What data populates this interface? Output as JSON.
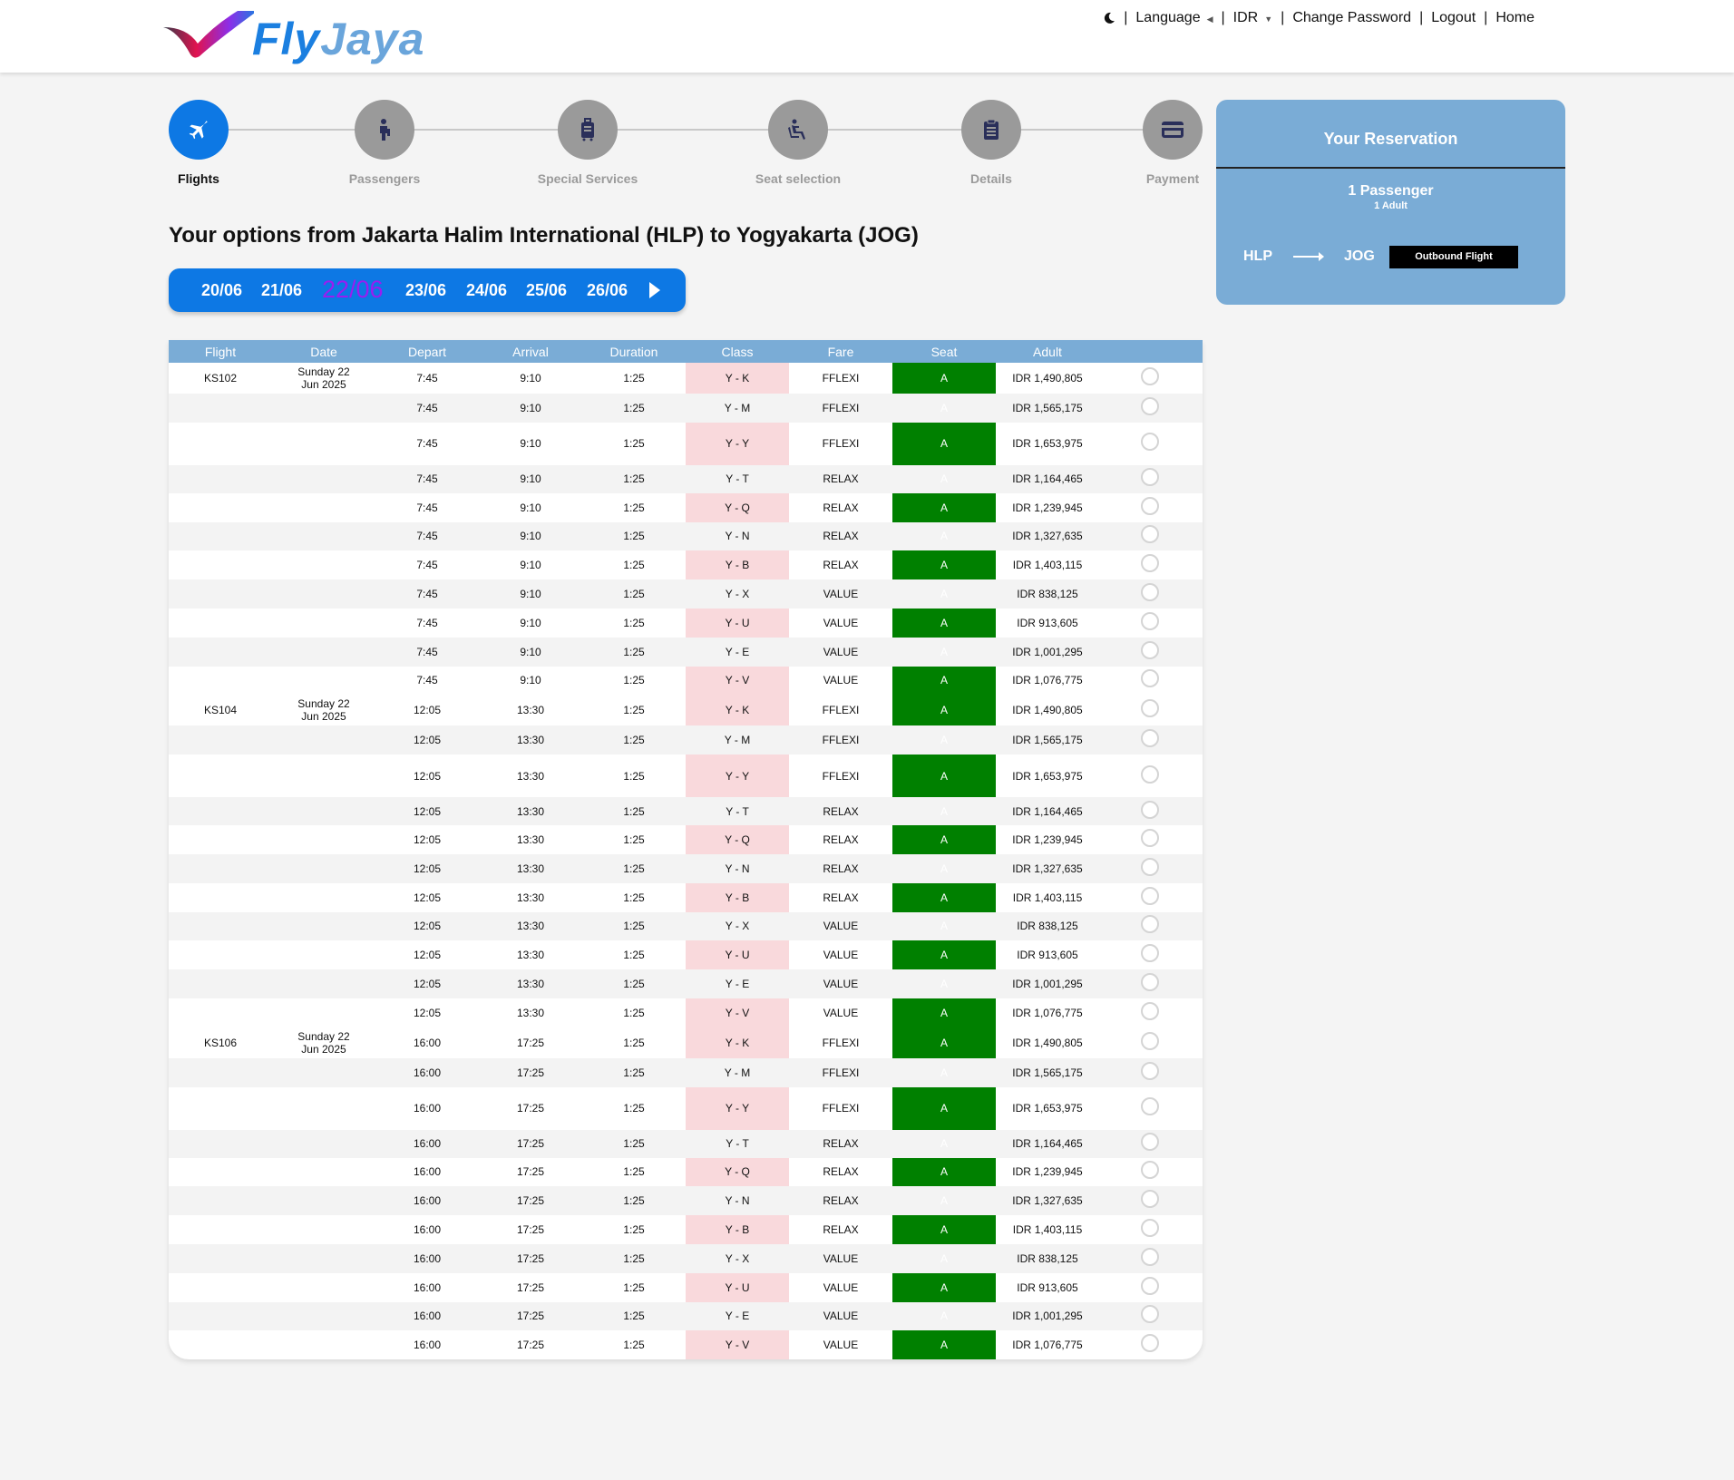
{
  "brand": {
    "name_part1": "Fly",
    "name_part2": "Jaya"
  },
  "topnav": {
    "items": [
      "Language",
      "IDR",
      "Change Password",
      "Logout",
      "Home"
    ],
    "separator": "|"
  },
  "steps": [
    {
      "label": "Flights",
      "icon": "plane-icon",
      "active": true
    },
    {
      "label": "Passengers",
      "icon": "person-icon",
      "active": false
    },
    {
      "label": "Special Services",
      "icon": "luggage-icon",
      "active": false
    },
    {
      "label": "Seat selection",
      "icon": "seat-icon",
      "active": false
    },
    {
      "label": "Details",
      "icon": "clipboard-icon",
      "active": false
    },
    {
      "label": "Payment",
      "icon": "credit-card-icon",
      "active": false
    }
  ],
  "route_title": "Your options from Jakarta Halim International (HLP) to Yogyakarta (JOG)",
  "dates": [
    "20/06",
    "21/06",
    "22/06",
    "23/06",
    "24/06",
    "25/06",
    "26/06"
  ],
  "selected_date": "22/06",
  "colors": {
    "primary": "#0d78e4",
    "selected_date": "#9b1cf0",
    "header": "#7aacd6",
    "class_band": "#f9d9dc",
    "seat_band": "#008000"
  },
  "table": {
    "headers": [
      "Flight",
      "Date",
      "Depart",
      "Arrival",
      "Duration",
      "Class",
      "Fare",
      "Seat",
      "Adult"
    ],
    "flights": [
      {
        "flight": "KS102",
        "date": "Sunday 22 Jun 2025",
        "depart": "7:45",
        "arrival": "9:10",
        "duration": "1:25",
        "fares": [
          {
            "class": "Y - K",
            "fare": "FFLEXI",
            "seat": "A",
            "adult": "IDR 1,490,805"
          },
          {
            "class": "Y - M",
            "fare": "FFLEXI",
            "seat": "A",
            "adult": "IDR 1,565,175"
          },
          {
            "class": "Y - Y",
            "fare": "FFLEXI",
            "seat": "A",
            "adult": "IDR 1,653,975"
          },
          {
            "class": "Y - T",
            "fare": "RELAX",
            "seat": "A",
            "adult": "IDR 1,164,465"
          },
          {
            "class": "Y - Q",
            "fare": "RELAX",
            "seat": "A",
            "adult": "IDR 1,239,945"
          },
          {
            "class": "Y - N",
            "fare": "RELAX",
            "seat": "A",
            "adult": "IDR 1,327,635"
          },
          {
            "class": "Y - B",
            "fare": "RELAX",
            "seat": "A",
            "adult": "IDR 1,403,115"
          },
          {
            "class": "Y - X",
            "fare": "VALUE",
            "seat": "A",
            "adult": "IDR 838,125"
          },
          {
            "class": "Y - U",
            "fare": "VALUE",
            "seat": "A",
            "adult": "IDR 913,605"
          },
          {
            "class": "Y - E",
            "fare": "VALUE",
            "seat": "A",
            "adult": "IDR 1,001,295"
          },
          {
            "class": "Y - V",
            "fare": "VALUE",
            "seat": "A",
            "adult": "IDR 1,076,775"
          }
        ]
      },
      {
        "flight": "KS104",
        "date": "Sunday 22 Jun 2025",
        "depart": "12:05",
        "arrival": "13:30",
        "duration": "1:25",
        "fares": [
          {
            "class": "Y - K",
            "fare": "FFLEXI",
            "seat": "A",
            "adult": "IDR 1,490,805"
          },
          {
            "class": "Y - M",
            "fare": "FFLEXI",
            "seat": "A",
            "adult": "IDR 1,565,175"
          },
          {
            "class": "Y - Y",
            "fare": "FFLEXI",
            "seat": "A",
            "adult": "IDR 1,653,975"
          },
          {
            "class": "Y - T",
            "fare": "RELAX",
            "seat": "A",
            "adult": "IDR 1,164,465"
          },
          {
            "class": "Y - Q",
            "fare": "RELAX",
            "seat": "A",
            "adult": "IDR 1,239,945"
          },
          {
            "class": "Y - N",
            "fare": "RELAX",
            "seat": "A",
            "adult": "IDR 1,327,635"
          },
          {
            "class": "Y - B",
            "fare": "RELAX",
            "seat": "A",
            "adult": "IDR 1,403,115"
          },
          {
            "class": "Y - X",
            "fare": "VALUE",
            "seat": "A",
            "adult": "IDR 838,125"
          },
          {
            "class": "Y - U",
            "fare": "VALUE",
            "seat": "A",
            "adult": "IDR 913,605"
          },
          {
            "class": "Y - E",
            "fare": "VALUE",
            "seat": "A",
            "adult": "IDR 1,001,295"
          },
          {
            "class": "Y - V",
            "fare": "VALUE",
            "seat": "A",
            "adult": "IDR 1,076,775"
          }
        ]
      },
      {
        "flight": "KS106",
        "date": "Sunday 22 Jun 2025",
        "depart": "16:00",
        "arrival": "17:25",
        "duration": "1:25",
        "fares": [
          {
            "class": "Y - K",
            "fare": "FFLEXI",
            "seat": "A",
            "adult": "IDR 1,490,805"
          },
          {
            "class": "Y - M",
            "fare": "FFLEXI",
            "seat": "A",
            "adult": "IDR 1,565,175"
          },
          {
            "class": "Y - Y",
            "fare": "FFLEXI",
            "seat": "A",
            "adult": "IDR 1,653,975"
          },
          {
            "class": "Y - T",
            "fare": "RELAX",
            "seat": "A",
            "adult": "IDR 1,164,465"
          },
          {
            "class": "Y - Q",
            "fare": "RELAX",
            "seat": "A",
            "adult": "IDR 1,239,945"
          },
          {
            "class": "Y - N",
            "fare": "RELAX",
            "seat": "A",
            "adult": "IDR 1,327,635"
          },
          {
            "class": "Y - B",
            "fare": "RELAX",
            "seat": "A",
            "adult": "IDR 1,403,115"
          },
          {
            "class": "Y - X",
            "fare": "VALUE",
            "seat": "A",
            "adult": "IDR 838,125"
          },
          {
            "class": "Y - U",
            "fare": "VALUE",
            "seat": "A",
            "adult": "IDR 913,605"
          },
          {
            "class": "Y - E",
            "fare": "VALUE",
            "seat": "A",
            "adult": "IDR 1,001,295"
          },
          {
            "class": "Y - V",
            "fare": "VALUE",
            "seat": "A",
            "adult": "IDR 1,076,775"
          }
        ]
      }
    ]
  },
  "reservation": {
    "title": "Your Reservation",
    "passengers": "1 Passenger",
    "passenger_detail": "1 Adult",
    "from": "HLP",
    "to": "JOG",
    "badge": "Outbound Flight"
  }
}
